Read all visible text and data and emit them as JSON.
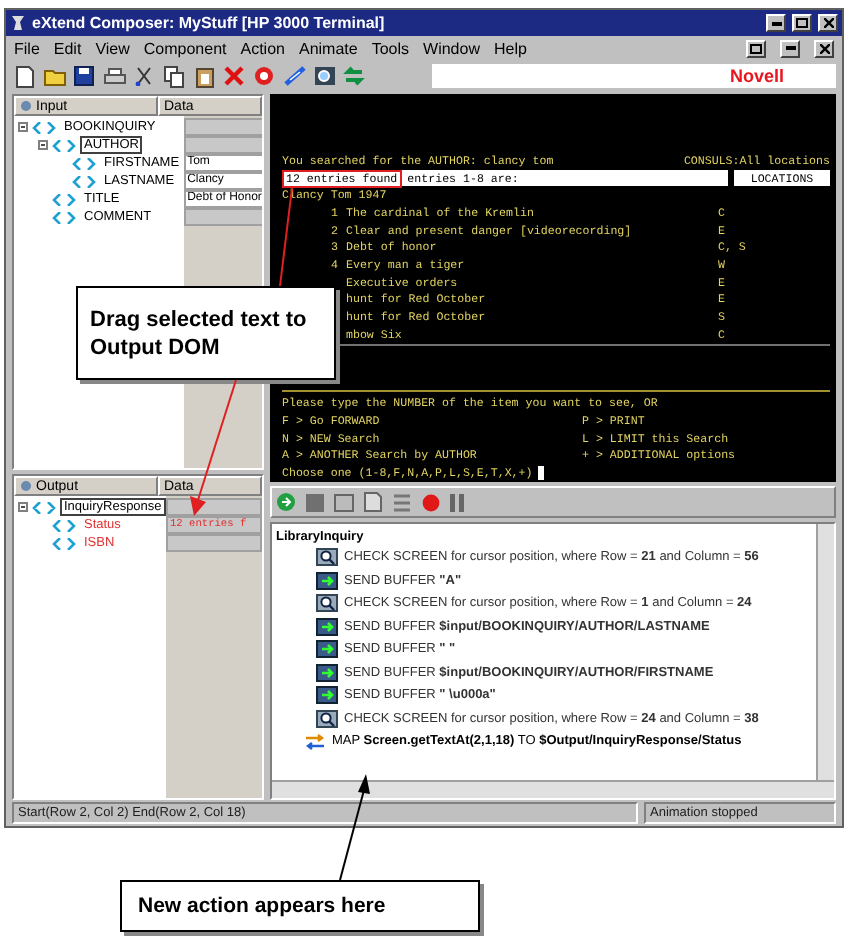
{
  "window": {
    "title": "eXtend Composer: MyStuff [HP 3000 Terminal]"
  },
  "menu": [
    "File",
    "Edit",
    "View",
    "Component",
    "Action",
    "Animate",
    "Tools",
    "Window",
    "Help"
  ],
  "brand": "Novell",
  "input_panel": {
    "header": "Input",
    "data_header": "Data",
    "tree": [
      {
        "label": "BOOKINQUIRY",
        "expanded": true,
        "selected": false,
        "children": [
          {
            "label": "AUTHOR",
            "expanded": true,
            "selected": true,
            "children": [
              {
                "label": "FIRSTNAME",
                "data": "Tom",
                "selected": false
              },
              {
                "label": "LASTNAME",
                "data": "Clancy",
                "selected": false
              }
            ]
          },
          {
            "label": "TITLE",
            "data": "Debt of Honor",
            "selected": false
          },
          {
            "label": "COMMENT",
            "selected": false
          }
        ]
      }
    ]
  },
  "output_panel": {
    "header": "Output",
    "data_header": "Data",
    "tree": [
      {
        "label": "InquiryResponse",
        "expanded": true,
        "selected": true,
        "mapped": false,
        "children": [
          {
            "label": "Status",
            "data": "12 entries f",
            "selected": false,
            "mapped": true
          },
          {
            "label": "ISBN",
            "selected": false,
            "mapped": true
          }
        ]
      }
    ]
  },
  "terminal": {
    "header_left": "You searched for the AUTHOR: clancy tom",
    "header_right": "CONSULS:All locations",
    "found": "12 entries found",
    "found_highlighted": true,
    "found_rest": "entries 1-8 are:",
    "locations": "LOCATIONS",
    "author_line": "Clancy Tom 1947",
    "entries": [
      {
        "number": "1",
        "title": "The cardinal of the Kremlin",
        "location": "C"
      },
      {
        "number": "2",
        "title": "Clear and present danger [videorecording]",
        "location": "E"
      },
      {
        "number": "3",
        "title": "Debt of honor",
        "location": "C, S"
      },
      {
        "number": "4",
        "title": "Every man a tiger",
        "location": "W"
      },
      {
        "title": "Executive orders",
        "location": "E"
      },
      {
        "title": "hunt for Red October",
        "location": "E"
      },
      {
        "title": "hunt for Red October",
        "location": "S"
      },
      {
        "title": "mbow Six",
        "location": "C"
      }
    ],
    "prompt_lines": [
      {
        "left": "Please type the NUMBER of the item you want to see, OR"
      },
      {
        "left": "F > Go FORWARD",
        "right": "P > PRINT"
      },
      {
        "left": "N > NEW Search",
        "right": "L > LIMIT this Search"
      },
      {
        "left": "A > ANOTHER Search by AUTHOR",
        "right": "+ > ADDITIONAL options"
      }
    ],
    "input_prompt": "Choose one (1-8,F,N,A,P,L,S,E,T,X,+)"
  },
  "actions": {
    "root": "LibraryInquiry",
    "items": [
      {
        "kind": "check",
        "text": "CHECK SCREEN for cursor position, where Row = **21** and Column = **56**"
      },
      {
        "kind": "send",
        "text": "SEND BUFFER **\"A\"**"
      },
      {
        "kind": "check",
        "text": "CHECK SCREEN for cursor position, where Row = **1** and Column = **24**"
      },
      {
        "kind": "send",
        "text": "SEND BUFFER **$input/BOOKINQUIRY/AUTHOR/LASTNAME**"
      },
      {
        "kind": "send",
        "text": "SEND BUFFER **\" \"**"
      },
      {
        "kind": "send",
        "text": "SEND BUFFER **$input/BOOKINQUIRY/AUTHOR/FIRSTNAME**"
      },
      {
        "kind": "send",
        "text": "SEND BUFFER **\" \\u000a\"**"
      },
      {
        "kind": "check",
        "text": "CHECK SCREEN for cursor position, where Row = **24** and Column = **38**"
      },
      {
        "kind": "map",
        "text": "MAP **Screen.getTextAt(2,1,18)** TO **$Output/InquiryResponse/Status**"
      }
    ]
  },
  "status_bar": {
    "position": "Start(Row 2, Col 2) End(Row 2, Col 18)",
    "animation": "Animation stopped"
  },
  "callouts": [
    {
      "text": "Drag selected text to Output DOM"
    },
    {
      "text": "New action appears here"
    }
  ]
}
